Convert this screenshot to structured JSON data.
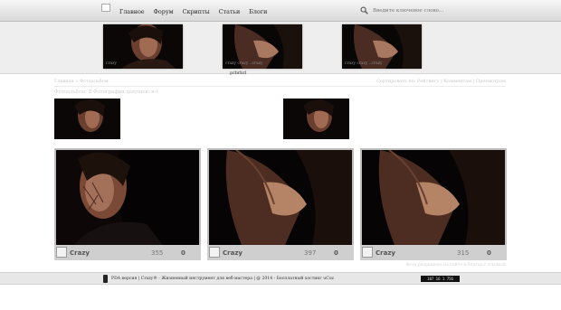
{
  "nav": {
    "items": [
      "Главное",
      "Форум",
      "Скрипты",
      "Статьи",
      "Блоги"
    ]
  },
  "search": {
    "placeholder": "Введите ключевое слово..."
  },
  "featured": {
    "captions": [
      "crazy",
      "crazy  crazy ..crazy",
      "crazy crazy ..crazy"
    ],
    "title": "prbrbrl"
  },
  "breadcrumbs": "Главная » Фотоальбом",
  "sort": "Сортировать по: Рейтингу | Комментам | Просмотрам",
  "heading": "Фотоальбом: 8 Фотографии девушек: в-1",
  "cards": [
    {
      "user": "Crazy",
      "views": "355",
      "comments": "0"
    },
    {
      "user": "Crazy",
      "views": "397",
      "comments": "0"
    },
    {
      "user": "Crazy",
      "views": "315",
      "comments": "0"
    }
  ],
  "pager_note": "Фото разрешено на сайте и блогах с ссылкой",
  "footer": {
    "text": "PDA версия | Crazy® - Жизненный инструмент для веб-мастера | @ 2014 - Бесплатный хостинг uCoz",
    "counter": "107 16 1 756"
  },
  "colors": {
    "topbar": "#dcdcdc",
    "strip": "#eeeeee",
    "card": "#bebebe",
    "footer": "#e7e7e7"
  }
}
